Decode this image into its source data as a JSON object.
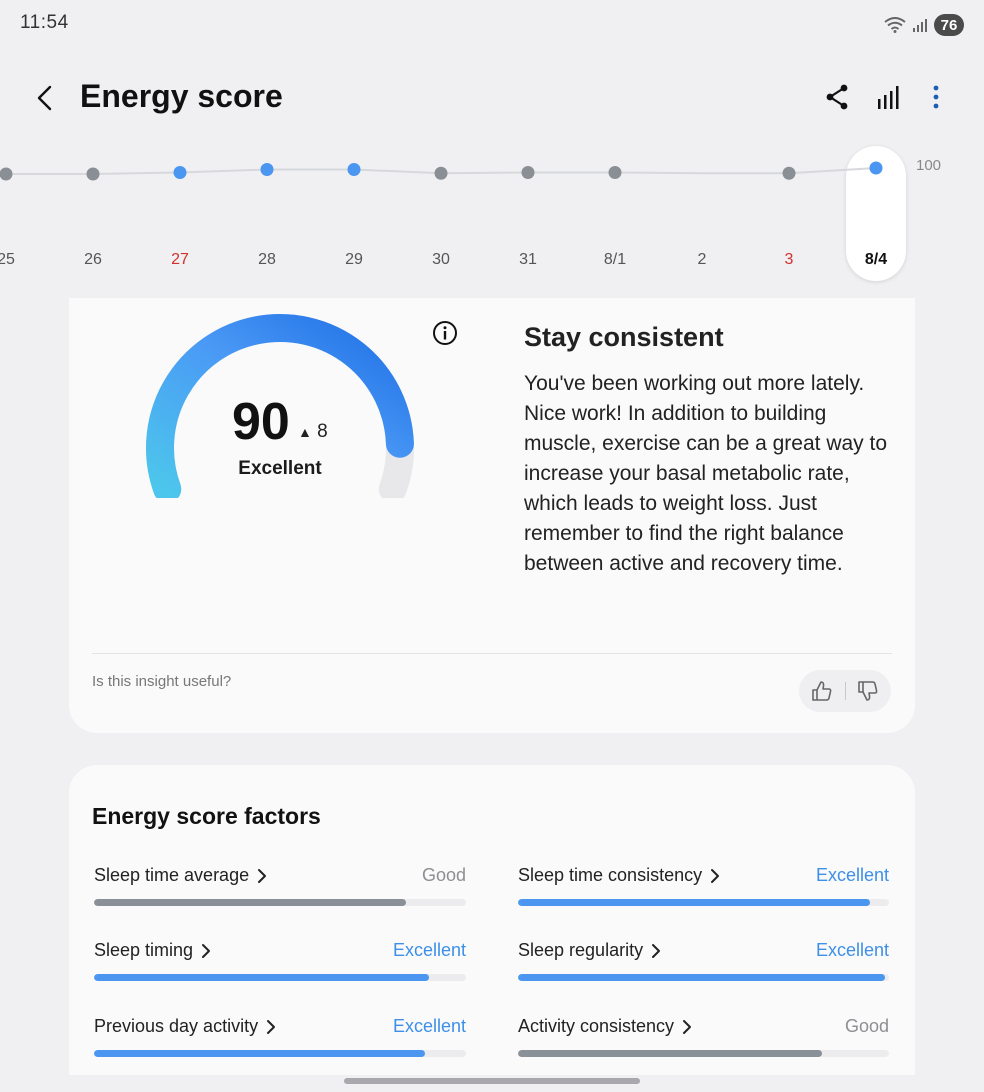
{
  "status": {
    "time": "11:54",
    "battery": "76"
  },
  "header": {
    "title": "Energy score"
  },
  "timeline": {
    "max_label": "100",
    "days": [
      {
        "label": "25",
        "score": 82,
        "color": "#8a8f96",
        "label_style": "normal"
      },
      {
        "label": "26",
        "score": 82,
        "color": "#8a8f96",
        "label_style": "normal"
      },
      {
        "label": "27",
        "score": 84,
        "color": "#4a96f0",
        "label_style": "red"
      },
      {
        "label": "28",
        "score": 88,
        "color": "#4a96f0",
        "label_style": "normal"
      },
      {
        "label": "29",
        "score": 88,
        "color": "#4a96f0",
        "label_style": "normal"
      },
      {
        "label": "30",
        "score": 83,
        "color": "#8a8f96",
        "label_style": "normal"
      },
      {
        "label": "31",
        "score": 84,
        "color": "#8a8f96",
        "label_style": "normal"
      },
      {
        "label": "8/1",
        "score": 84,
        "color": "#8a8f96",
        "label_style": "normal"
      },
      {
        "label": "2",
        "score": 83,
        "color": "#8a8f96",
        "label_style": "hidden-dot"
      },
      {
        "label": "3",
        "score": 83,
        "color": "#8a8f96",
        "label_style": "red"
      },
      {
        "label": "8/4",
        "score": 90,
        "color": "#4a96f0",
        "label_style": "selected"
      }
    ]
  },
  "score": {
    "value": "90",
    "delta": "8",
    "rating": "Excellent",
    "fraction": 0.9
  },
  "insight": {
    "title": "Stay consistent",
    "body": "You've been working out more lately. Nice work! In addition to building muscle, exercise can be a great way to increase your basal metabolic rate, which leads to weight loss. Just remember to find the right balance between active and recovery time.",
    "feedback_question": "Is this insight useful?"
  },
  "factors": {
    "title": "Energy score factors",
    "items": [
      {
        "name": "Sleep time average",
        "status": "Good",
        "level": 0.84,
        "color": "#8a9097",
        "status_color": "#8e8e93"
      },
      {
        "name": "Sleep time consistency",
        "status": "Excellent",
        "level": 0.95,
        "color": "#4a96f0",
        "status_color": "#3d8fe8"
      },
      {
        "name": "Sleep timing",
        "status": "Excellent",
        "level": 0.9,
        "color": "#4a96f0",
        "status_color": "#3d8fe8"
      },
      {
        "name": "Sleep regularity",
        "status": "Excellent",
        "level": 0.99,
        "color": "#4a96f0",
        "status_color": "#3d8fe8"
      },
      {
        "name": "Previous day activity",
        "status": "Excellent",
        "level": 0.89,
        "color": "#4a96f0",
        "status_color": "#3d8fe8"
      },
      {
        "name": "Activity consistency",
        "status": "Good",
        "level": 0.82,
        "color": "#8a9097",
        "status_color": "#8e8e93"
      }
    ]
  },
  "icons": {
    "back": "chevron-left-icon",
    "share": "share-icon",
    "stats": "bar-chart-icon",
    "more": "more-vertical-icon",
    "info": "info-icon",
    "like": "thumbs-up-icon",
    "dislike": "thumbs-down-icon"
  }
}
